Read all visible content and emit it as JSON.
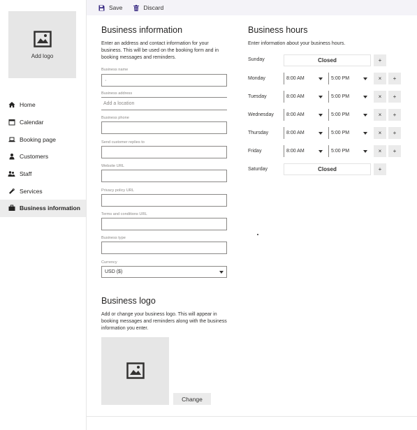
{
  "sidebar": {
    "add_logo_label": "Add logo",
    "items": [
      {
        "label": "Home",
        "icon": "home-icon"
      },
      {
        "label": "Calendar",
        "icon": "calendar-icon"
      },
      {
        "label": "Booking page",
        "icon": "laptop-icon"
      },
      {
        "label": "Customers",
        "icon": "person-icon"
      },
      {
        "label": "Staff",
        "icon": "people-icon"
      },
      {
        "label": "Services",
        "icon": "wrench-icon"
      },
      {
        "label": "Business information",
        "icon": "briefcase-icon",
        "active": true
      }
    ]
  },
  "toolbar": {
    "save_label": "Save",
    "discard_label": "Discard"
  },
  "business_info": {
    "title": "Business information",
    "description": "Enter an address and contact information for your business. This will be used on the booking form and in booking messages and reminders.",
    "fields": {
      "name_label": "Business name",
      "name_value": "·",
      "address_label": "Business address",
      "address_placeholder": "Add a location",
      "phone_label": "Business phone",
      "replies_label": "Send customer replies to",
      "website_label": "Website URL",
      "privacy_label": "Privacy policy URL",
      "terms_label": "Terms and conditions URL",
      "type_label": "Business type",
      "currency_label": "Currency",
      "currency_value": "USD ($)"
    }
  },
  "business_logo": {
    "title": "Business logo",
    "description": "Add or change your business logo. This will appear in booking messages and reminders along with the business information you enter.",
    "change_label": "Change"
  },
  "business_hours": {
    "title": "Business hours",
    "description": "Enter information about your business hours.",
    "closed_label": "Closed",
    "remove_label": "×",
    "add_label": "+",
    "days": [
      {
        "day": "Sunday",
        "closed": true
      },
      {
        "day": "Monday",
        "start": "8:00 AM",
        "end": "5:00 PM"
      },
      {
        "day": "Tuesday",
        "start": "8:00 AM",
        "end": "5:00 PM"
      },
      {
        "day": "Wednesday",
        "start": "8:00 AM",
        "end": "5:00 PM"
      },
      {
        "day": "Thursday",
        "start": "8:00 AM",
        "end": "5:00 PM"
      },
      {
        "day": "Friday",
        "start": "8:00 AM",
        "end": "5:00 PM"
      },
      {
        "day": "Saturday",
        "closed": true
      }
    ]
  }
}
